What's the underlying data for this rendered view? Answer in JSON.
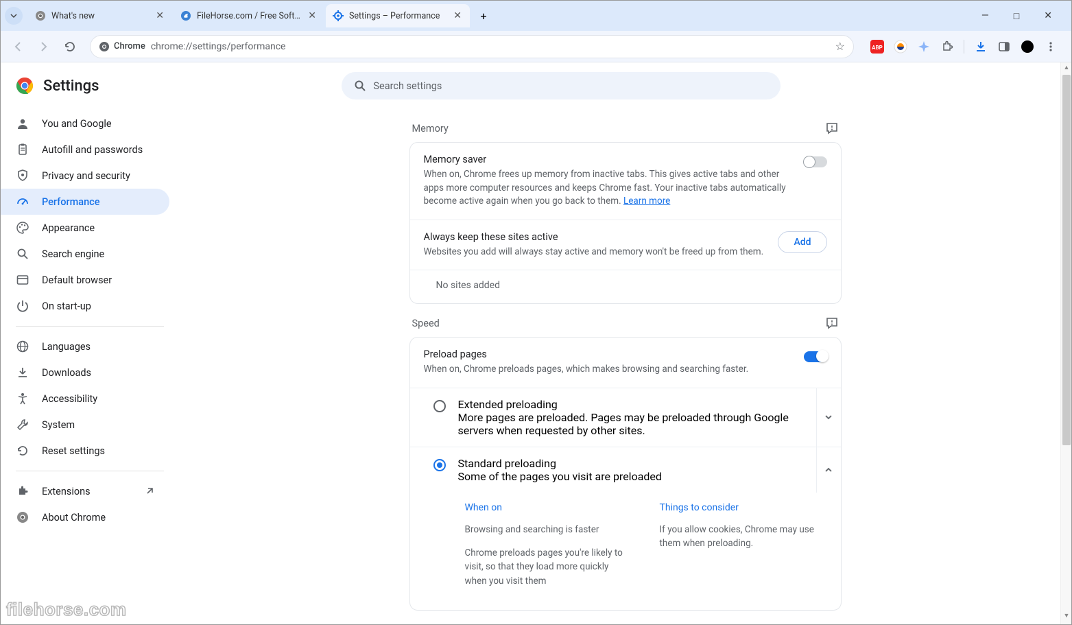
{
  "tabs": [
    {
      "title": "What's new",
      "favicon": "chrome-gray"
    },
    {
      "title": "FileHorse.com / Free Software",
      "favicon": "filehorse"
    },
    {
      "title": "Settings – Performance",
      "favicon": "gear-blue",
      "active": true
    }
  ],
  "window": {
    "minimize": "—",
    "maximize": "□",
    "close": "✕"
  },
  "nav": {
    "back": "←",
    "forward": "→",
    "reload": "⟳"
  },
  "omnibox": {
    "label": "Chrome",
    "url": "chrome://settings/performance",
    "star": "☆"
  },
  "extensions": [
    "abp",
    "similarweb",
    "sparkle",
    "puzzle",
    "download",
    "panel",
    "profile",
    "menu"
  ],
  "header": {
    "title": "Settings"
  },
  "search": {
    "placeholder": "Search settings"
  },
  "sidebar": [
    {
      "icon": "person",
      "label": "You and Google"
    },
    {
      "icon": "clipboard",
      "label": "Autofill and passwords"
    },
    {
      "icon": "shield",
      "label": "Privacy and security"
    },
    {
      "icon": "speed",
      "label": "Performance",
      "active": true
    },
    {
      "icon": "palette",
      "label": "Appearance"
    },
    {
      "icon": "search",
      "label": "Search engine"
    },
    {
      "icon": "browser",
      "label": "Default browser"
    },
    {
      "icon": "power",
      "label": "On start-up"
    },
    {
      "divider": true
    },
    {
      "icon": "globe",
      "label": "Languages"
    },
    {
      "icon": "download",
      "label": "Downloads"
    },
    {
      "icon": "a11y",
      "label": "Accessibility"
    },
    {
      "icon": "wrench",
      "label": "System"
    },
    {
      "icon": "reset",
      "label": "Reset settings"
    },
    {
      "divider": true
    },
    {
      "icon": "ext",
      "label": "Extensions",
      "external": true
    },
    {
      "icon": "chrome-gray",
      "label": "About Chrome"
    }
  ],
  "memory": {
    "heading": "Memory",
    "saver": {
      "title": "Memory saver",
      "desc": "When on, Chrome frees up memory from inactive tabs. This gives active tabs and other apps more computer resources and keeps Chrome fast. Your inactive tabs automatically become active again when you go back to them. ",
      "learn": "Learn more",
      "on": false
    },
    "keep": {
      "title": "Always keep these sites active",
      "desc": "Websites you add will always stay active and memory won't be freed up from them.",
      "add": "Add",
      "empty": "No sites added"
    }
  },
  "speed": {
    "heading": "Speed",
    "preload": {
      "title": "Preload pages",
      "desc": "When on, Chrome preloads pages, which makes browsing and searching faster.",
      "on": true
    },
    "extended": {
      "title": "Extended preloading",
      "desc": "More pages are preloaded. Pages may be preloaded through Google servers when requested by other sites.",
      "selected": false
    },
    "standard": {
      "title": "Standard preloading",
      "desc": "Some of the pages you visit are preloaded",
      "selected": true,
      "whenon_h": "When on",
      "whenon_1": "Browsing and searching is faster",
      "whenon_2": "Chrome preloads pages you're likely to visit, so that they load more quickly when you visit them",
      "consider_h": "Things to consider",
      "consider_1": "If you allow cookies, Chrome may use them when preloading."
    }
  },
  "watermark": "filehorse.com"
}
